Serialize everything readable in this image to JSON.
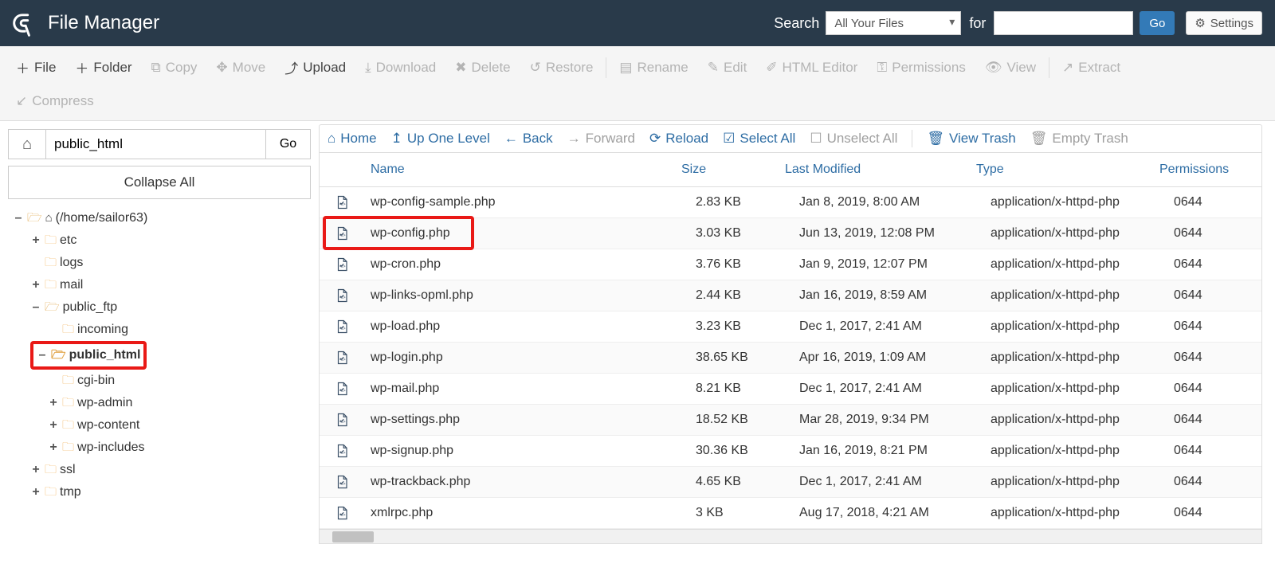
{
  "header": {
    "app_title": "File Manager",
    "search_label": "Search",
    "search_scope": "All Your Files",
    "for_label": "for",
    "search_value": "",
    "go_label": "Go",
    "settings_label": "Settings"
  },
  "toolbar": {
    "file": "File",
    "folder": "Folder",
    "copy": "Copy",
    "move": "Move",
    "upload": "Upload",
    "download": "Download",
    "delete": "Delete",
    "restore": "Restore",
    "rename": "Rename",
    "edit": "Edit",
    "html_editor": "HTML Editor",
    "permissions": "Permissions",
    "view": "View",
    "extract": "Extract",
    "compress": "Compress"
  },
  "left": {
    "path_value": "public_html",
    "go_label": "Go",
    "collapse_all": "Collapse All",
    "root_label": "(/home/sailor63)",
    "nodes": {
      "etc": "etc",
      "logs": "logs",
      "mail": "mail",
      "public_ftp": "public_ftp",
      "incoming": "incoming",
      "public_html": "public_html",
      "cgi_bin": "cgi-bin",
      "wp_admin": "wp-admin",
      "wp_content": "wp-content",
      "wp_includes": "wp-includes",
      "ssl": "ssl",
      "tmp": "tmp"
    }
  },
  "actions": {
    "home": "Home",
    "up": "Up One Level",
    "back": "Back",
    "forward": "Forward",
    "reload": "Reload",
    "select_all": "Select All",
    "unselect_all": "Unselect All",
    "view_trash": "View Trash",
    "empty_trash": "Empty Trash"
  },
  "columns": {
    "name": "Name",
    "size": "Size",
    "modified": "Last Modified",
    "type": "Type",
    "permissions": "Permissions"
  },
  "files": [
    {
      "name": "wp-config-sample.php",
      "size": "2.83 KB",
      "modified": "Jan 8, 2019, 8:00 AM",
      "type": "application/x-httpd-php",
      "perm": "0644"
    },
    {
      "name": "wp-config.php",
      "size": "3.03 KB",
      "modified": "Jun 13, 2019, 12:08 PM",
      "type": "application/x-httpd-php",
      "perm": "0644"
    },
    {
      "name": "wp-cron.php",
      "size": "3.76 KB",
      "modified": "Jan 9, 2019, 12:07 PM",
      "type": "application/x-httpd-php",
      "perm": "0644"
    },
    {
      "name": "wp-links-opml.php",
      "size": "2.44 KB",
      "modified": "Jan 16, 2019, 8:59 AM",
      "type": "application/x-httpd-php",
      "perm": "0644"
    },
    {
      "name": "wp-load.php",
      "size": "3.23 KB",
      "modified": "Dec 1, 2017, 2:41 AM",
      "type": "application/x-httpd-php",
      "perm": "0644"
    },
    {
      "name": "wp-login.php",
      "size": "38.65 KB",
      "modified": "Apr 16, 2019, 1:09 AM",
      "type": "application/x-httpd-php",
      "perm": "0644"
    },
    {
      "name": "wp-mail.php",
      "size": "8.21 KB",
      "modified": "Dec 1, 2017, 2:41 AM",
      "type": "application/x-httpd-php",
      "perm": "0644"
    },
    {
      "name": "wp-settings.php",
      "size": "18.52 KB",
      "modified": "Mar 28, 2019, 9:34 PM",
      "type": "application/x-httpd-php",
      "perm": "0644"
    },
    {
      "name": "wp-signup.php",
      "size": "30.36 KB",
      "modified": "Jan 16, 2019, 8:21 PM",
      "type": "application/x-httpd-php",
      "perm": "0644"
    },
    {
      "name": "wp-trackback.php",
      "size": "4.65 KB",
      "modified": "Dec 1, 2017, 2:41 AM",
      "type": "application/x-httpd-php",
      "perm": "0644"
    },
    {
      "name": "xmlrpc.php",
      "size": "3 KB",
      "modified": "Aug 17, 2018, 4:21 AM",
      "type": "application/x-httpd-php",
      "perm": "0644"
    }
  ]
}
